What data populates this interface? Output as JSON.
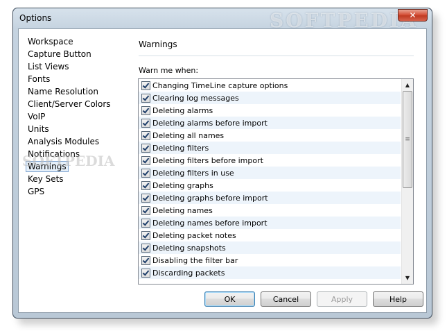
{
  "window": {
    "title": "Options",
    "watermark": "SOFTPEDIA",
    "close_icon": "close-x"
  },
  "sidebar": {
    "items": [
      {
        "label": "Workspace"
      },
      {
        "label": "Capture Button"
      },
      {
        "label": "List Views"
      },
      {
        "label": "Fonts"
      },
      {
        "label": "Name Resolution"
      },
      {
        "label": "Client/Server Colors"
      },
      {
        "label": "VoIP"
      },
      {
        "label": "Units"
      },
      {
        "label": "Analysis Modules"
      },
      {
        "label": "Notifications"
      },
      {
        "label": "Warnings",
        "selected": true
      },
      {
        "label": "Key Sets"
      },
      {
        "label": "GPS"
      }
    ]
  },
  "panel": {
    "title": "Warnings",
    "warn_label": "Warn me when:",
    "items": [
      {
        "label": "Changing TimeLine capture options",
        "checked": true
      },
      {
        "label": "Clearing log messages",
        "checked": true
      },
      {
        "label": "Deleting alarms",
        "checked": true
      },
      {
        "label": "Deleting alarms before import",
        "checked": true
      },
      {
        "label": "Deleting all names",
        "checked": true
      },
      {
        "label": "Deleting filters",
        "checked": true
      },
      {
        "label": "Deleting filters before import",
        "checked": true
      },
      {
        "label": "Deleting filters in use",
        "checked": true
      },
      {
        "label": "Deleting graphs",
        "checked": true
      },
      {
        "label": "Deleting graphs before import",
        "checked": true
      },
      {
        "label": "Deleting names",
        "checked": true
      },
      {
        "label": "Deleting names before import",
        "checked": true
      },
      {
        "label": "Deleting packet notes",
        "checked": true
      },
      {
        "label": "Deleting snapshots",
        "checked": true
      },
      {
        "label": "Disabling the filter bar",
        "checked": true
      },
      {
        "label": "Discarding packets",
        "checked": true
      }
    ]
  },
  "buttons": {
    "ok": "OK",
    "cancel": "Cancel",
    "apply": "Apply",
    "help": "Help"
  }
}
